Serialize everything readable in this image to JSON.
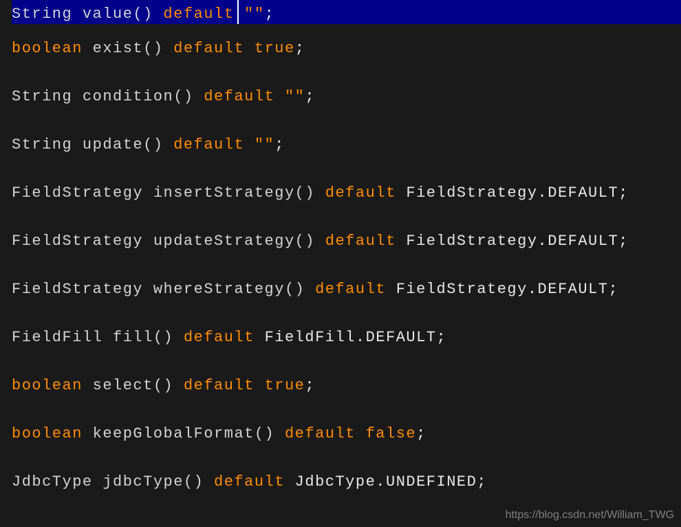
{
  "lines": [
    {
      "highlighted": true,
      "tokens": [
        {
          "text": "String value() ",
          "cls": "tk-type"
        },
        {
          "text": "default ",
          "cls": "tk-keyword"
        },
        {
          "text": "\"\"",
          "cls": "tk-keyword"
        },
        {
          "text": ";",
          "cls": "tk-punct"
        }
      ]
    },
    {
      "tokens": [
        {
          "text": "boolean",
          "cls": "tk-kw-boolean"
        },
        {
          "text": " exist() ",
          "cls": "tk-type"
        },
        {
          "text": "default ",
          "cls": "tk-keyword"
        },
        {
          "text": "true",
          "cls": "tk-keyword"
        },
        {
          "text": ";",
          "cls": "tk-punct"
        }
      ]
    },
    {
      "tokens": [
        {
          "text": "String condition() ",
          "cls": "tk-type"
        },
        {
          "text": "default ",
          "cls": "tk-keyword"
        },
        {
          "text": "\"\"",
          "cls": "tk-keyword"
        },
        {
          "text": ";",
          "cls": "tk-punct"
        }
      ]
    },
    {
      "tokens": [
        {
          "text": "String update() ",
          "cls": "tk-type"
        },
        {
          "text": "default ",
          "cls": "tk-keyword"
        },
        {
          "text": "\"\"",
          "cls": "tk-keyword"
        },
        {
          "text": ";",
          "cls": "tk-punct"
        }
      ]
    },
    {
      "tokens": [
        {
          "text": "FieldStrategy insertStrategy() ",
          "cls": "tk-type"
        },
        {
          "text": "default ",
          "cls": "tk-keyword"
        },
        {
          "text": "FieldStrategy.DEFAULT;",
          "cls": "tk-default"
        }
      ]
    },
    {
      "tokens": [
        {
          "text": "FieldStrategy updateStrategy() ",
          "cls": "tk-type"
        },
        {
          "text": "default ",
          "cls": "tk-keyword"
        },
        {
          "text": "FieldStrategy.DEFAULT;",
          "cls": "tk-default"
        }
      ]
    },
    {
      "tokens": [
        {
          "text": "FieldStrategy whereStrategy() ",
          "cls": "tk-type"
        },
        {
          "text": "default ",
          "cls": "tk-keyword"
        },
        {
          "text": "FieldStrategy.DEFAULT;",
          "cls": "tk-default"
        }
      ]
    },
    {
      "tokens": [
        {
          "text": "FieldFill fill() ",
          "cls": "tk-type"
        },
        {
          "text": "default ",
          "cls": "tk-keyword"
        },
        {
          "text": "FieldFill.DEFAULT;",
          "cls": "tk-default"
        }
      ]
    },
    {
      "tokens": [
        {
          "text": "boolean",
          "cls": "tk-kw-boolean"
        },
        {
          "text": " select() ",
          "cls": "tk-type"
        },
        {
          "text": "default ",
          "cls": "tk-keyword"
        },
        {
          "text": "true",
          "cls": "tk-keyword"
        },
        {
          "text": ";",
          "cls": "tk-punct"
        }
      ]
    },
    {
      "tokens": [
        {
          "text": "boolean",
          "cls": "tk-kw-boolean"
        },
        {
          "text": " keepGlobalFormat() ",
          "cls": "tk-type"
        },
        {
          "text": "default ",
          "cls": "tk-keyword"
        },
        {
          "text": "false",
          "cls": "tk-keyword"
        },
        {
          "text": ";",
          "cls": "tk-punct"
        }
      ]
    },
    {
      "tokens": [
        {
          "text": "JdbcType jdbcType() ",
          "cls": "tk-type"
        },
        {
          "text": "default ",
          "cls": "tk-keyword"
        },
        {
          "text": "JdbcType.UNDEFINED;",
          "cls": "tk-default"
        }
      ]
    }
  ],
  "watermark": "https://blog.csdn.net/William_TWG"
}
